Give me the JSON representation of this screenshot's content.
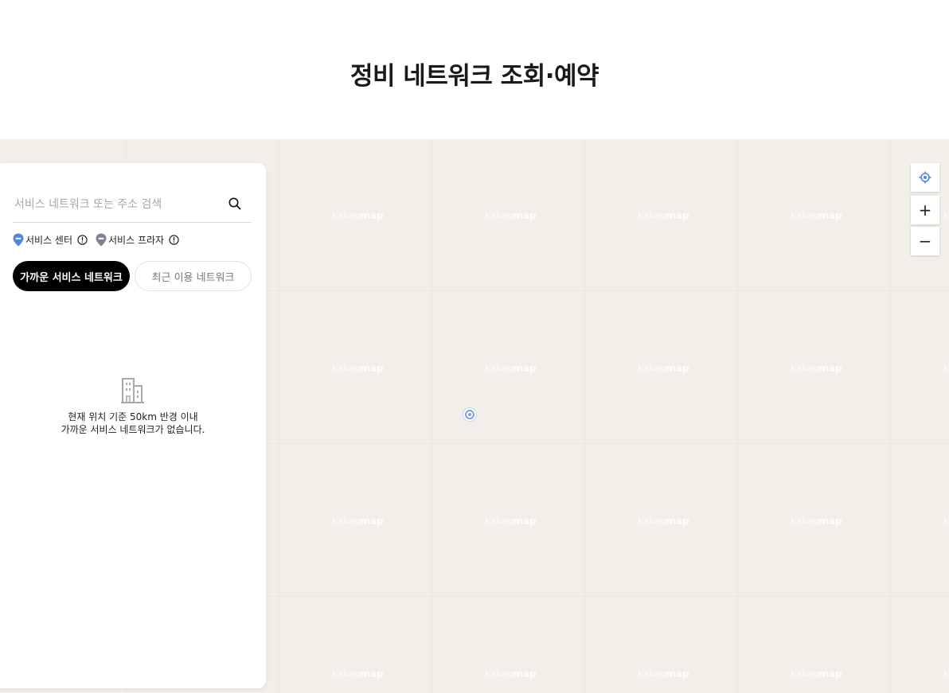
{
  "page": {
    "title": "정비 네트워크 조회·예약"
  },
  "search": {
    "placeholder": "서비스 네트워크 또는 주소 검색",
    "value": "",
    "icon": "search-icon"
  },
  "legend": {
    "items": [
      {
        "label": "서비스 센터",
        "pin_color": "#4f86e0",
        "icon": "info-icon"
      },
      {
        "label": "서비스 프라자",
        "pin_color": "#7b8591",
        "icon": "info-icon"
      }
    ]
  },
  "tabs": [
    {
      "label": "가까운 서비스 네트워크",
      "active": true
    },
    {
      "label": "최근 이용 네트워크",
      "active": false
    }
  ],
  "empty_state": {
    "icon": "building-icon",
    "line1": "현재 위치 기준 50km 반경 이내",
    "line2": "가까운 서비스 네트워크가 없습니다."
  },
  "map": {
    "watermark_light": "kakao",
    "watermark_bold": "map",
    "background_color": "#f2efe9",
    "controls": {
      "locate_icon": "crosshair-icon",
      "zoom_in_label": "+",
      "zoom_out_label": "−"
    }
  },
  "colors": {
    "primary_button": "#000000",
    "location_marker": "#7fa1d9"
  }
}
